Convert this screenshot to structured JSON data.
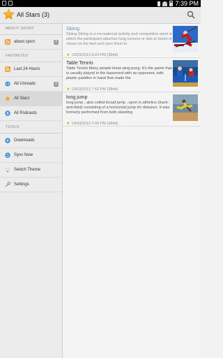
{
  "status_bar": {
    "time": "7:39 PM"
  },
  "action_bar": {
    "title": "All Stars (3)"
  },
  "sidebar": {
    "sections": [
      {
        "header": "ABOUT SPORT",
        "items": [
          {
            "label": "about sport",
            "badge": "4",
            "icon": "rss-icon"
          }
        ]
      },
      {
        "header": "FAVORITES",
        "items": [
          {
            "label": "Last 24 Hours",
            "icon": "rss-icon"
          },
          {
            "label": "All Unreads",
            "badge": "4",
            "icon": "globe-icon"
          },
          {
            "label": "All Stars",
            "icon": "star-icon",
            "active": true
          },
          {
            "label": "All Podcasts",
            "icon": "podcast-icon"
          }
        ]
      },
      {
        "header": "TOOLS",
        "items": [
          {
            "label": "Downloads",
            "icon": "download-icon"
          },
          {
            "label": "Sync Now",
            "icon": "sync-icon"
          },
          {
            "label": "Switch Theme",
            "icon": "theme-icon"
          },
          {
            "label": "Settings",
            "icon": "settings-icon"
          }
        ]
      }
    ]
  },
  "articles": [
    {
      "title": "Skiing",
      "body": "Skiing Skiing  is a recreational activity and competitive sport in which the participant attaches long runners or skis  to boots or shoes on the feet and uses them to",
      "meta": "13/03/2013 8:23 PM (384d)",
      "read": true
    },
    {
      "title": "Table Tennis",
      "body": "Table Tennis Many people know ping-pong. It's the game that is usually played in the basement with an opponent, with plastic paddles in hand that made the",
      "meta": "13/03/2013 7:52 PM (384d)",
      "read": false
    },
    {
      "title": "long jump",
      "body": "long jump ,  also called  broad jump ,  sport in athletics (track-and-field) consisting of a horizontal jump for distance. It was formerly performed from both standing",
      "meta": "13/03/2013 7:43 PM (384d)",
      "read": false
    }
  ],
  "colors": {
    "star": "#f0a800",
    "rss": "#f39a1e",
    "globe": "#3b8fd8"
  }
}
